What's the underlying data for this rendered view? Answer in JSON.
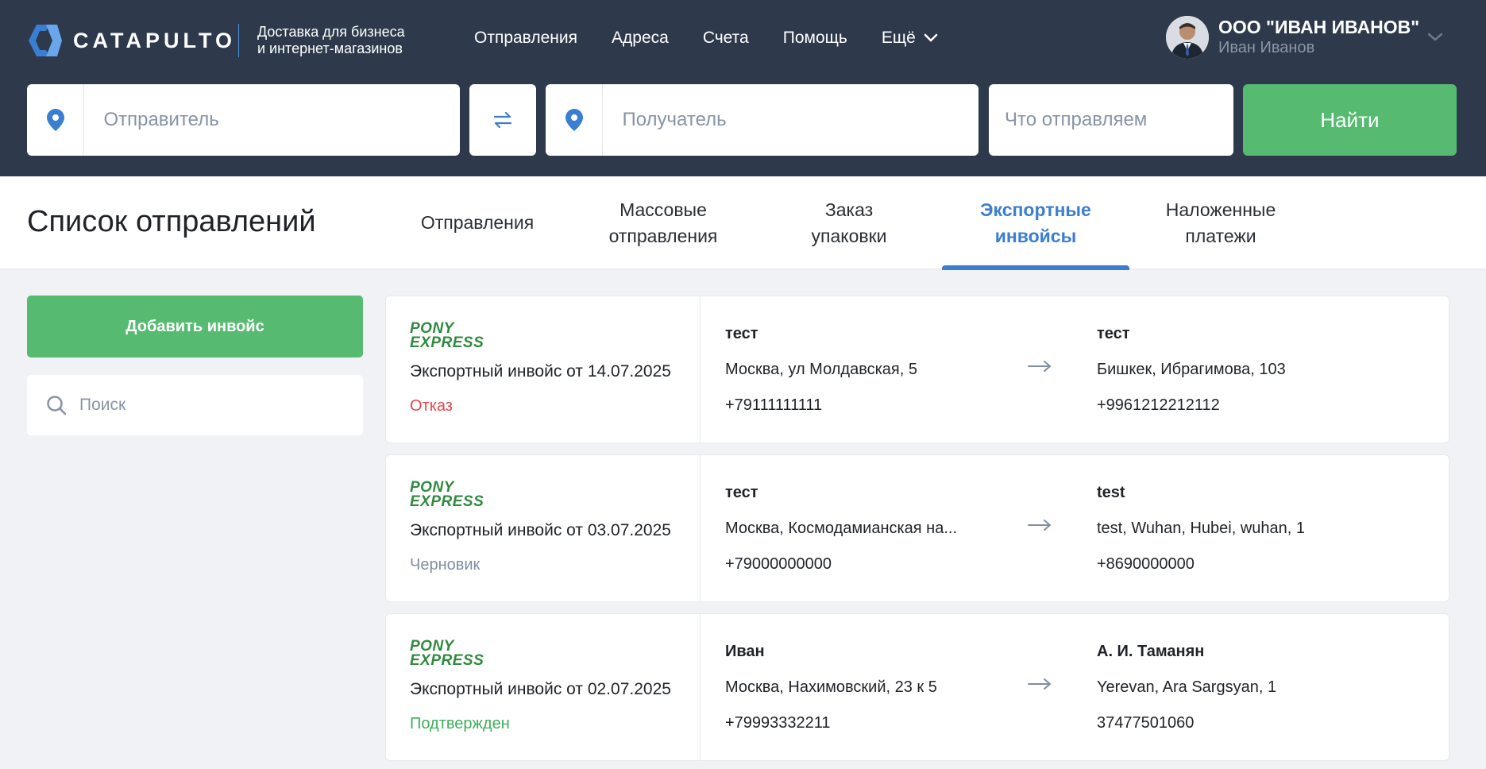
{
  "header": {
    "logo_text": "CATAPULTO",
    "tagline_line1": "Доставка для бизнеса",
    "tagline_line2": "и интернет-магазинов",
    "nav": [
      "Отправления",
      "Адреса",
      "Счета",
      "Помощь"
    ],
    "nav_more": "Ещё",
    "user_company": "ООО \"ИВАН ИВАНОВ\"",
    "user_name": "Иван Иванов"
  },
  "search": {
    "sender_placeholder": "Отправитель",
    "receiver_placeholder": "Получатель",
    "what_placeholder": "Что отправляем",
    "find_label": "Найти"
  },
  "page": {
    "title": "Список отправлений",
    "tabs": [
      {
        "line1": "Отправления",
        "line2": ""
      },
      {
        "line1": "Массовые",
        "line2": "отправления"
      },
      {
        "line1": "Заказ",
        "line2": "упаковки"
      },
      {
        "line1": "Экспортные",
        "line2": "инвойсы"
      },
      {
        "line1": "Наложенные",
        "line2": "платежи"
      }
    ],
    "active_tab": 3
  },
  "sidebar": {
    "add_label": "Добавить инвойс",
    "search_placeholder": "Поиск"
  },
  "carrier": {
    "line1": "PONY",
    "line2": "EXPRESS"
  },
  "invoices": [
    {
      "title": "Экспортный инвойс от 14.07.2025",
      "status": "Отказ",
      "status_color": "#e5484d",
      "from": {
        "name": "тест",
        "address": "Москва, ул Молдавская, 5",
        "phone": "+79111111111"
      },
      "to": {
        "name": "тест",
        "address": "Бишкек, Ибрагимова, 103",
        "phone": "+9961212212112"
      }
    },
    {
      "title": "Экспортный инвойс от 03.07.2025",
      "status": "Черновик",
      "status_color": "#7f8ea3",
      "from": {
        "name": "тест",
        "address": "Москва, Космодамианская на...",
        "phone": "+79000000000"
      },
      "to": {
        "name": "test",
        "address": "test, Wuhan, Hubei, wuhan, 1",
        "phone": "+8690000000"
      }
    },
    {
      "title": "Экспортный инвойс от 02.07.2025",
      "status": "Подтвержден",
      "status_color": "#3fae5c",
      "from": {
        "name": "Иван",
        "address": "Москва, Нахимовский, 23 к 5",
        "phone": "+79993332211"
      },
      "to": {
        "name": "А. И. Таманян",
        "address": "Yerevan, Ara Sargsyan, 1",
        "phone": "37477501060"
      }
    }
  ],
  "colors": {
    "accent": "#3a7ed2",
    "green": "#56bb70",
    "header_bg": "#2e3a4c"
  }
}
